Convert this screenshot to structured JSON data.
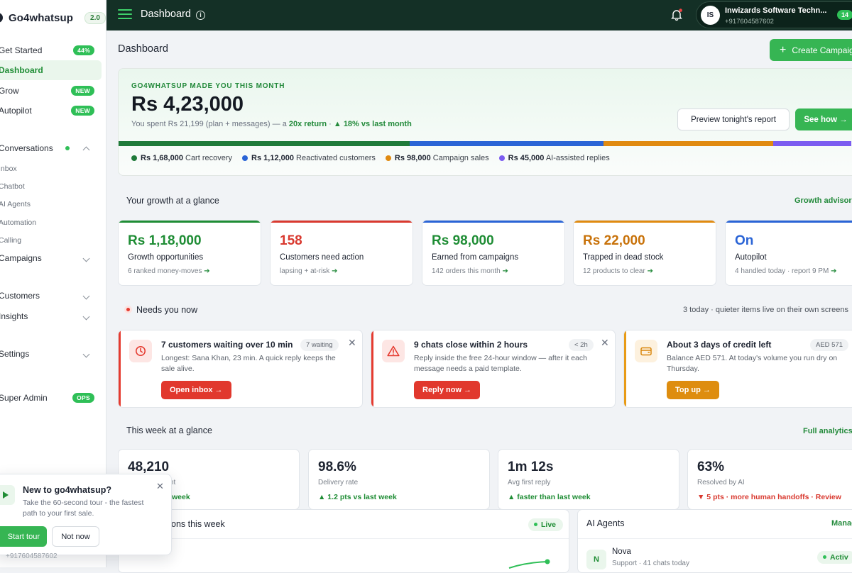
{
  "brand": {
    "name": "Go4whatsup",
    "version": "2.0"
  },
  "sidebar": {
    "items": [
      {
        "label": "Get Started",
        "badge": "44%"
      },
      {
        "label": "Dashboard"
      },
      {
        "label": "Grow",
        "badge": "NEW"
      },
      {
        "label": "Autopilot",
        "badge": "NEW"
      },
      {
        "label": "Conversations"
      },
      {
        "label": "Campaigns"
      },
      {
        "label": "Customers"
      },
      {
        "label": "Insights"
      },
      {
        "label": "Settings"
      },
      {
        "label": "Super Admin",
        "badge": "OPS"
      }
    ],
    "sub_items": [
      "Inbox",
      "Chatbot",
      "AI Agents",
      "Automation",
      "Calling"
    ]
  },
  "topbar": {
    "title": "Dashboard",
    "account_initials": "IS",
    "account_name": "Inwizards Software Techn...",
    "account_phone": "+917604587602",
    "count": "14"
  },
  "page": {
    "title": "Dashboard",
    "create_button": "Create Campaign"
  },
  "hero": {
    "eyebrow": "GO4WHATSUP MADE YOU THIS MONTH",
    "amount": "Rs 4,23,000",
    "sub_prefix": "You spent Rs 21,199 (plan + messages) — a",
    "sub_return": "20x return",
    "sub_sep": "·",
    "sub_delta": "▲ 18% vs last month",
    "preview_button": "Preview tonight's report",
    "seehow_button": "See how →",
    "legend": [
      {
        "value": "Rs 1,68,000",
        "label": "Cart recovery",
        "color": "#1f7a3a",
        "amount": 168000
      },
      {
        "value": "Rs 1,12,000",
        "label": "Reactivated customers",
        "color": "#2a64d6",
        "amount": 112000
      },
      {
        "value": "Rs 98,000",
        "label": "Campaign sales",
        "color": "#e08a10",
        "amount": 98000
      },
      {
        "value": "Rs 45,000",
        "label": "AI-assisted replies",
        "color": "#7b5cf0",
        "amount": 45000
      }
    ]
  },
  "growth": {
    "title": "Your growth at a glance",
    "link": "Growth advisor",
    "cards": [
      {
        "value": "Rs 1,18,000",
        "label": "Growth opportunities",
        "hint": "6 ranked money-moves",
        "color": "#1f8d35"
      },
      {
        "value": "158",
        "label": "Customers need action",
        "hint": "lapsing + at-risk",
        "color": "#d9392f"
      },
      {
        "value": "Rs 98,000",
        "label": "Earned from campaigns",
        "hint": "142 orders this month",
        "color": "#1f8d35"
      },
      {
        "value": "Rs 22,000",
        "label": "Trapped in dead stock",
        "hint": "12 products to clear",
        "color": "#c8720a"
      },
      {
        "value": "On",
        "label": "Autopilot",
        "hint": "4 handled today · report 9 PM",
        "color": "#2a64d6"
      }
    ],
    "arrow": "➔"
  },
  "needs": {
    "title": "Needs you now",
    "note": "3 today · quieter items live on their own screens",
    "alerts": [
      {
        "title": "7 customers waiting over 10 min",
        "chip": "7 waiting",
        "desc": "Longest: Sana Khan, 23 min. A quick reply keeps the sale alive.",
        "action": "Open inbox →",
        "close": "✕"
      },
      {
        "title": "9 chats close within 2 hours",
        "chip": "< 2h",
        "desc": "Reply inside the free 24-hour window — after it each message needs a paid template.",
        "action": "Reply now →",
        "close": "✕"
      },
      {
        "title": "About 3 days of credit left",
        "chip": "AED 571",
        "desc": "Balance AED 571. At today's volume you run dry on Thursday.",
        "action": "Top up →"
      }
    ]
  },
  "week": {
    "title": "This week at a glance",
    "link": "Full analytics",
    "kpis": [
      {
        "value": "48,210",
        "label": "nt",
        "trend": "week"
      },
      {
        "value": "98.6%",
        "label": "Delivery rate",
        "trend": "▲ 1.2 pts vs last week"
      },
      {
        "value": "1m 12s",
        "label": "Avg first reply",
        "trend": "▲ faster than last week"
      },
      {
        "value": "63%",
        "label": "Resolved by AI",
        "trend": "▼ 5 pts · more human handoffs · Review"
      }
    ]
  },
  "conversations_panel": {
    "title": "ons this week",
    "live": "Live"
  },
  "ai_panel": {
    "title": "AI Agents",
    "link": "Manag",
    "agent_initial": "N",
    "agent_name": "Nova",
    "agent_meta": "Support · 41 chats today",
    "agent_status": "Activ"
  },
  "tour": {
    "title": "New to go4whatsup?",
    "desc": "Take the 60-second tour - the fastest path to your first sale.",
    "start": "Start tour",
    "later": "Not now",
    "close": "✕",
    "phone": "+917604587602"
  }
}
